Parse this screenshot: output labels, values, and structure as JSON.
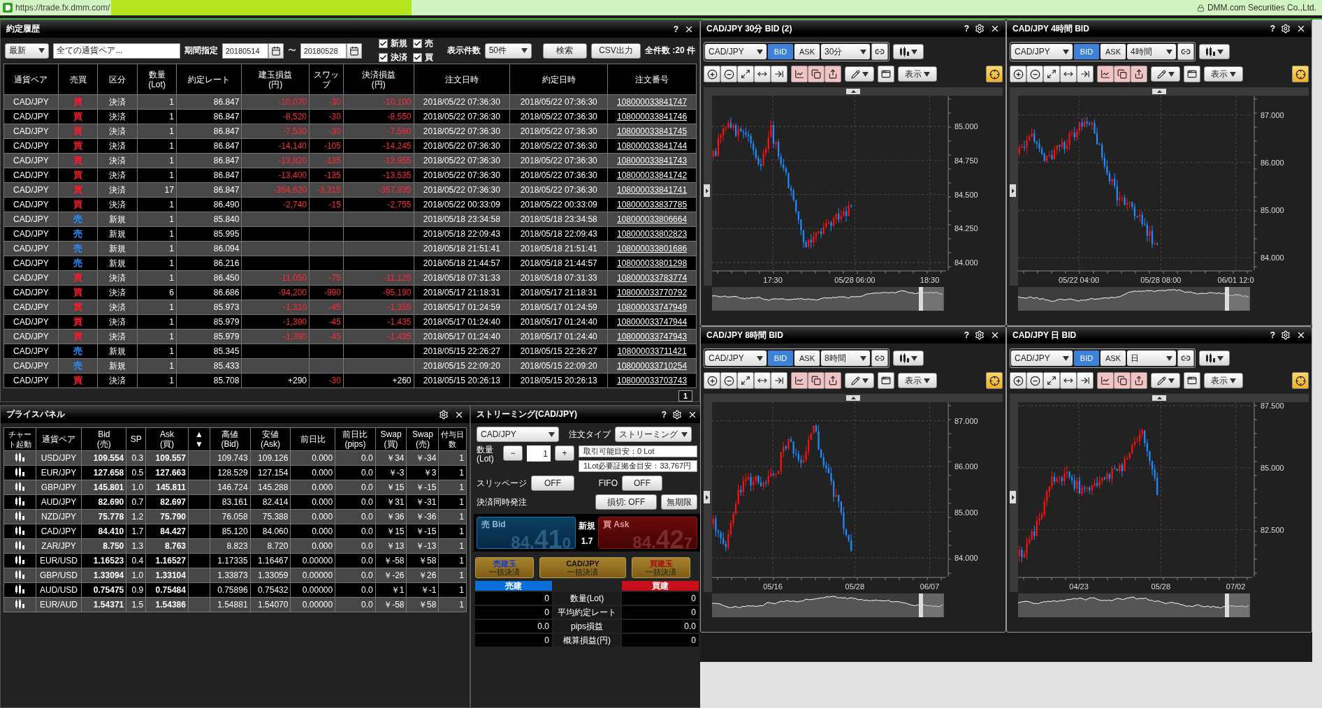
{
  "browser": {
    "url": "https://trade.fx.dmm.com/",
    "site": "DMM.com Securities Co.,Ltd."
  },
  "history": {
    "title": "約定履歴",
    "help": "?",
    "filters": {
      "sort": "最新",
      "pair": "全ての通貨ペア...",
      "period_label": "期間指定",
      "from": "20180514",
      "tilde": "〜",
      "to": "20180528",
      "checks": [
        {
          "label": "新規",
          "checked": true
        },
        {
          "label": "売",
          "checked": true
        },
        {
          "label": "決済",
          "checked": true
        },
        {
          "label": "買",
          "checked": true
        }
      ],
      "count_label": "表示件数",
      "count": "50件",
      "buttons": [
        "検索",
        "CSV出力"
      ],
      "total": "全件数 :20 件"
    },
    "columns": [
      "通貨ペア",
      "売買",
      "区分",
      "数量\n(Lot)",
      "約定レート",
      "建玉損益\n(円)",
      "スワップ",
      "決済損益\n(円)",
      "注文日時",
      "約定日時",
      "注文番号"
    ],
    "rows": [
      {
        "pair": "CAD/JPY",
        "side": "買",
        "color": "#ff1a2e",
        "type": "決済",
        "lots": "1",
        "rate": "86.847",
        "pnl": {
          "text": "-10,070",
          "loss": true
        },
        "swap": {
          "text": "-30",
          "loss": true
        },
        "settled": {
          "text": "-10,100",
          "loss": true
        },
        "ordered": "2018/05/22 07:36:30",
        "executed": "2018/05/22 07:36:30",
        "order_no": "108000033841747"
      },
      {
        "pair": "CAD/JPY",
        "side": "買",
        "color": "#ff1a2e",
        "type": "決済",
        "lots": "1",
        "rate": "86.847",
        "pnl": {
          "text": "-8,520",
          "loss": true
        },
        "swap": {
          "text": "-30",
          "loss": true
        },
        "settled": {
          "text": "-8,550",
          "loss": true
        },
        "ordered": "2018/05/22 07:36:30",
        "executed": "2018/05/22 07:36:30",
        "order_no": "108000033841746"
      },
      {
        "pair": "CAD/JPY",
        "side": "買",
        "color": "#ff1a2e",
        "type": "決済",
        "lots": "1",
        "rate": "86.847",
        "pnl": {
          "text": "-7,530",
          "loss": true
        },
        "swap": {
          "text": "-30",
          "loss": true
        },
        "settled": {
          "text": "-7,560",
          "loss": true
        },
        "ordered": "2018/05/22 07:36:30",
        "executed": "2018/05/22 07:36:30",
        "order_no": "108000033841745"
      },
      {
        "pair": "CAD/JPY",
        "side": "買",
        "color": "#ff1a2e",
        "type": "決済",
        "lots": "1",
        "rate": "86.847",
        "pnl": {
          "text": "-14,140",
          "loss": true
        },
        "swap": {
          "text": "-105",
          "loss": true
        },
        "settled": {
          "text": "-14,245",
          "loss": true
        },
        "ordered": "2018/05/22 07:36:30",
        "executed": "2018/05/22 07:36:30",
        "order_no": "108000033841744"
      },
      {
        "pair": "CAD/JPY",
        "side": "買",
        "color": "#ff1a2e",
        "type": "決済",
        "lots": "1",
        "rate": "86.847",
        "pnl": {
          "text": "-13,820",
          "loss": true
        },
        "swap": {
          "text": "-135",
          "loss": true
        },
        "settled": {
          "text": "-13,955",
          "loss": true
        },
        "ordered": "2018/05/22 07:36:30",
        "executed": "2018/05/22 07:36:30",
        "order_no": "108000033841743"
      },
      {
        "pair": "CAD/JPY",
        "side": "買",
        "color": "#ff1a2e",
        "type": "決済",
        "lots": "1",
        "rate": "86.847",
        "pnl": {
          "text": "-13,400",
          "loss": true
        },
        "swap": {
          "text": "-135",
          "loss": true
        },
        "settled": {
          "text": "-13,535",
          "loss": true
        },
        "ordered": "2018/05/22 07:36:30",
        "executed": "2018/05/22 07:36:30",
        "order_no": "108000033841742"
      },
      {
        "pair": "CAD/JPY",
        "side": "買",
        "color": "#ff1a2e",
        "type": "決済",
        "lots": "17",
        "rate": "86.847",
        "pnl": {
          "text": "-354,620",
          "loss": true
        },
        "swap": {
          "text": "-3,315",
          "loss": true
        },
        "settled": {
          "text": "-357,935",
          "loss": true
        },
        "ordered": "2018/05/22 07:36:30",
        "executed": "2018/05/22 07:36:30",
        "order_no": "108000033841741"
      },
      {
        "pair": "CAD/JPY",
        "side": "買",
        "color": "#ff1a2e",
        "type": "決済",
        "lots": "1",
        "rate": "86.490",
        "pnl": {
          "text": "-2,740",
          "loss": true
        },
        "swap": {
          "text": "-15",
          "loss": true
        },
        "settled": {
          "text": "-2,755",
          "loss": true
        },
        "ordered": "2018/05/22 00:33:09",
        "executed": "2018/05/22 00:33:09",
        "order_no": "108000033837785"
      },
      {
        "pair": "CAD/JPY",
        "side": "売",
        "color": "#2a8cff",
        "type": "新規",
        "lots": "1",
        "rate": "85.840",
        "ordered": "2018/05/18 23:34:58",
        "executed": "2018/05/18 23:34:58",
        "order_no": "108000033806664"
      },
      {
        "pair": "CAD/JPY",
        "side": "売",
        "color": "#2a8cff",
        "type": "新規",
        "lots": "1",
        "rate": "85.995",
        "ordered": "2018/05/18 22:09:43",
        "executed": "2018/05/18 22:09:43",
        "order_no": "108000033802823"
      },
      {
        "pair": "CAD/JPY",
        "side": "売",
        "color": "#2a8cff",
        "type": "新規",
        "lots": "1",
        "rate": "86.094",
        "ordered": "2018/05/18 21:51:41",
        "executed": "2018/05/18 21:51:41",
        "order_no": "108000033801686"
      },
      {
        "pair": "CAD/JPY",
        "side": "売",
        "color": "#2a8cff",
        "type": "新規",
        "lots": "1",
        "rate": "86.216",
        "ordered": "2018/05/18 21:44:57",
        "executed": "2018/05/18 21:44:57",
        "order_no": "108000033801298"
      },
      {
        "pair": "CAD/JPY",
        "side": "買",
        "color": "#ff1a2e",
        "type": "決済",
        "lots": "1",
        "rate": "86.450",
        "pnl": {
          "text": "-11,050",
          "loss": true
        },
        "swap": {
          "text": "-75",
          "loss": true
        },
        "settled": {
          "text": "-11,125",
          "loss": true
        },
        "ordered": "2018/05/18 07:31:33",
        "executed": "2018/05/18 07:31:33",
        "order_no": "108000033783774"
      },
      {
        "pair": "CAD/JPY",
        "side": "買",
        "color": "#ff1a2e",
        "type": "決済",
        "lots": "6",
        "rate": "86.686",
        "pnl": {
          "text": "-94,200",
          "loss": true
        },
        "swap": {
          "text": "-990",
          "loss": true
        },
        "settled": {
          "text": "-95,190",
          "loss": true
        },
        "ordered": "2018/05/17 21:18:31",
        "executed": "2018/05/17 21:18:31",
        "order_no": "108000033770792"
      },
      {
        "pair": "CAD/JPY",
        "side": "買",
        "color": "#ff1a2e",
        "type": "決済",
        "lots": "1",
        "rate": "85.973",
        "pnl": {
          "text": "-1,310",
          "loss": true
        },
        "swap": {
          "text": "-45",
          "loss": true
        },
        "settled": {
          "text": "-1,355",
          "loss": true
        },
        "ordered": "2018/05/17 01:24:59",
        "executed": "2018/05/17 01:24:59",
        "order_no": "108000033747949"
      },
      {
        "pair": "CAD/JPY",
        "side": "買",
        "color": "#ff1a2e",
        "type": "決済",
        "lots": "1",
        "rate": "85.979",
        "pnl": {
          "text": "-1,390",
          "loss": true
        },
        "swap": {
          "text": "-45",
          "loss": true
        },
        "settled": {
          "text": "-1,435",
          "loss": true
        },
        "ordered": "2018/05/17 01:24:40",
        "executed": "2018/05/17 01:24:40",
        "order_no": "108000033747944"
      },
      {
        "pair": "CAD/JPY",
        "side": "買",
        "color": "#ff1a2e",
        "type": "決済",
        "lots": "1",
        "rate": "85.979",
        "pnl": {
          "text": "-1,390",
          "loss": true
        },
        "swap": {
          "text": "-45",
          "loss": true
        },
        "settled": {
          "text": "-1,435",
          "loss": true
        },
        "ordered": "2018/05/17 01:24:40",
        "executed": "2018/05/17 01:24:40",
        "order_no": "108000033747943"
      },
      {
        "pair": "CAD/JPY",
        "side": "売",
        "color": "#2a8cff",
        "type": "新規",
        "lots": "1",
        "rate": "85.345",
        "ordered": "2018/05/15 22:26:27",
        "executed": "2018/05/15 22:26:27",
        "order_no": "108000033711421"
      },
      {
        "pair": "CAD/JPY",
        "side": "売",
        "color": "#2a8cff",
        "type": "新規",
        "lots": "1",
        "rate": "85.433",
        "ordered": "2018/05/15 22:09:20",
        "executed": "2018/05/15 22:09:20",
        "order_no": "108000033710254"
      },
      {
        "pair": "CAD/JPY",
        "side": "買",
        "color": "#ff1a2e",
        "type": "決済",
        "lots": "1",
        "rate": "85.708",
        "pnl": {
          "text": "+290",
          "loss": false
        },
        "swap": {
          "text": "-30",
          "loss": true
        },
        "settled": {
          "text": "+260",
          "loss": false
        },
        "ordered": "2018/05/15 20:26:13",
        "executed": "2018/05/15 20:26:13",
        "order_no": "108000033703743"
      }
    ],
    "page": "1"
  },
  "prices": {
    "title": "プライスパネル",
    "columns": [
      "チャート起動",
      "通貨ペア",
      "Bid\n(売)",
      "SP",
      "Ask\n(買)",
      "▲\n▼",
      "高値\n(Bid)",
      "安値\n(Ask)",
      "前日比",
      "前日比\n(pips)",
      "Swap\n(買)",
      "Swap\n(売)",
      "付与日数"
    ],
    "rows": [
      {
        "cells": [
          "",
          "USD/JPY",
          "109.554",
          "0.3",
          "109.557",
          "",
          "109.743",
          "109.126",
          "0.000",
          "0.0",
          "￥34",
          "￥-34",
          "1"
        ]
      },
      {
        "cells": [
          "",
          "EUR/JPY",
          "127.658",
          "0.5",
          "127.663",
          "",
          "128.529",
          "127.154",
          "0.000",
          "0.0",
          "￥-3",
          "￥3",
          "1"
        ]
      },
      {
        "cells": [
          "",
          "GBP/JPY",
          "145.801",
          "1.0",
          "145.811",
          "",
          "146.724",
          "145.288",
          "0.000",
          "0.0",
          "￥15",
          "￥-15",
          "1"
        ]
      },
      {
        "cells": [
          "",
          "AUD/JPY",
          "82.690",
          "0.7",
          "82.697",
          "",
          "83.161",
          "82.414",
          "0.000",
          "0.0",
          "￥31",
          "￥-31",
          "1"
        ]
      },
      {
        "cells": [
          "",
          "NZD/JPY",
          "75.778",
          "1.2",
          "75.790",
          "",
          "76.058",
          "75.388",
          "0.000",
          "0.0",
          "￥36",
          "￥-36",
          "1"
        ]
      },
      {
        "cells": [
          "",
          "CAD/JPY",
          "84.410",
          "1.7",
          "84.427",
          "",
          "85.120",
          "84.060",
          "0.000",
          "0.0",
          "￥15",
          "￥-15",
          "1"
        ]
      },
      {
        "cells": [
          "",
          "ZAR/JPY",
          "8.750",
          "1.3",
          "8.763",
          "",
          "8.823",
          "8.720",
          "0.000",
          "0.0",
          "￥13",
          "￥-13",
          "1"
        ]
      },
      {
        "cells": [
          "",
          "EUR/USD",
          "1.16523",
          "0.4",
          "1.16527",
          "",
          "1.17335",
          "1.16467",
          "0.00000",
          "0.0",
          "￥-58",
          "￥58",
          "1"
        ]
      },
      {
        "cells": [
          "",
          "GBP/USD",
          "1.33094",
          "1.0",
          "1.33104",
          "",
          "1.33873",
          "1.33059",
          "0.00000",
          "0.0",
          "￥-26",
          "￥26",
          "1"
        ]
      },
      {
        "cells": [
          "",
          "AUD/USD",
          "0.75475",
          "0.9",
          "0.75484",
          "",
          "0.75896",
          "0.75432",
          "0.00000",
          "0.0",
          "￥1",
          "￥-1",
          "1"
        ]
      },
      {
        "cells": [
          "",
          "EUR/AUD",
          "1.54371",
          "1.5",
          "1.54386",
          "",
          "1.54881",
          "1.54070",
          "0.00000",
          "0.0",
          "￥-58",
          "￥58",
          "1"
        ]
      }
    ]
  },
  "stream": {
    "title": "ストリーミング(CAD/JPY)",
    "help": "?",
    "pair": "CAD/JPY",
    "order_type_label": "注文タイプ",
    "order_type": "ストリーミング",
    "qty_label": "数量\n(Lot)",
    "minus": "−",
    "qty": "1",
    "plus": "+",
    "info": [
      "取引可能目安：0 Lot",
      "1Lot必要証拠金目安：33,767円"
    ],
    "slippage_label": "スリッページ",
    "slippage": "OFF",
    "fifo_label": "FIFO",
    "fifo": "OFF",
    "settle_label": "決済同時発注",
    "stop": "損切: OFF",
    "expiry": "無期限",
    "bid": {
      "label": "売 Bid",
      "parts": [
        "84.",
        "41",
        "0"
      ]
    },
    "new_label": "新規",
    "spread": "1.7",
    "ask": {
      "label": "買 Ask",
      "parts": [
        "84.",
        "42",
        "7"
      ]
    },
    "bulk": [
      {
        "line1": "売建玉",
        "color": "#1840c0",
        "line2": "一括決済"
      },
      {
        "line1": "CAD/JPY",
        "color": "#111111",
        "line2": "一括決済"
      },
      {
        "line1": "買建玉",
        "color": "#a01010",
        "line2": "一括決済"
      }
    ],
    "sell_header": "売建",
    "buy_header": "買建",
    "summary": [
      {
        "label": "数量(Lot)",
        "sell": "0",
        "buy": "0"
      },
      {
        "label": "平均約定レート",
        "sell": "0",
        "buy": "0"
      },
      {
        "label": "pips損益",
        "sell": "0.0",
        "buy": "0.0"
      },
      {
        "label": "概算損益(円)",
        "sell": "0",
        "buy": "0"
      }
    ]
  },
  "charts": [
    {
      "title": "CAD/JPY 30分 BID (2)",
      "help": "?",
      "pair": "CAD/JPY",
      "sides": [
        {
          "label": "BID",
          "selected": true
        },
        {
          "label": "ASK",
          "selected": false
        }
      ],
      "timeframe": "30分",
      "view": "表示",
      "y_labels": [
        "85.000",
        "84.750",
        "84.500",
        "84.250",
        "84.000"
      ],
      "x_labels": [
        "17:30",
        "05/28 06:00",
        "18:30"
      ]
    },
    {
      "title": "CAD/JPY 4時間 BID",
      "help": "?",
      "pair": "CAD/JPY",
      "sides": [
        {
          "label": "BID",
          "selected": true
        },
        {
          "label": "ASK",
          "selected": false
        }
      ],
      "timeframe": "4時間",
      "view": "表示",
      "y_labels": [
        "87.000",
        "86.000",
        "85.000",
        "84.000"
      ],
      "x_labels": [
        "05/22 04:00",
        "05/28 08:00",
        "06/01 12:0"
      ]
    },
    {
      "title": "CAD/JPY 8時間 BID",
      "help": "?",
      "pair": "CAD/JPY",
      "sides": [
        {
          "label": "BID",
          "selected": true
        },
        {
          "label": "ASK",
          "selected": false
        }
      ],
      "timeframe": "8時間",
      "view": "表示",
      "y_labels": [
        "87.000",
        "86.000",
        "85.000",
        "84.000"
      ],
      "x_labels": [
        "05/16",
        "05/28",
        "06/07"
      ]
    },
    {
      "title": "CAD/JPY 日 BID",
      "help": "?",
      "pair": "CAD/JPY",
      "sides": [
        {
          "label": "BID",
          "selected": true
        },
        {
          "label": "ASK",
          "selected": false
        }
      ],
      "timeframe": "日",
      "view": "表示",
      "y_labels": [
        "87.500",
        "85.000",
        "82.500"
      ],
      "x_labels": [
        "04/23",
        "05/28",
        "07/02"
      ]
    }
  ]
}
